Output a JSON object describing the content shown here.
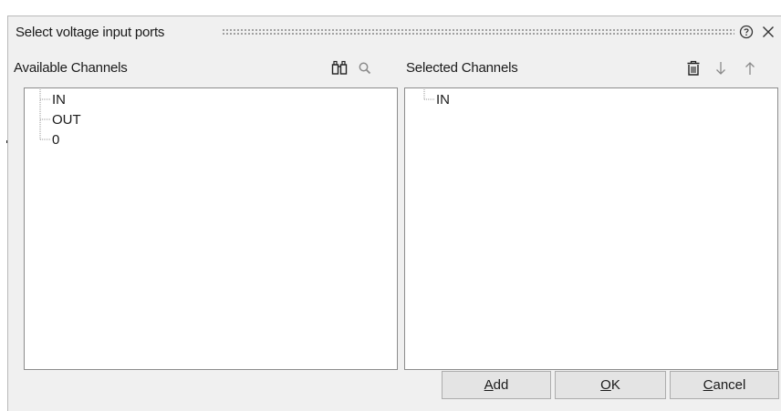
{
  "dialog": {
    "title": "Select voltage input ports",
    "help_icon": "help-circle-icon",
    "close_icon": "close-icon"
  },
  "available": {
    "header": "Available Channels",
    "tools": [
      "binoculars-icon",
      "search-icon"
    ],
    "items": [
      "IN",
      "OUT",
      "0"
    ]
  },
  "selected": {
    "header": "Selected Channels",
    "tools": [
      "trash-icon",
      "arrow-down-icon",
      "arrow-up-icon"
    ],
    "items": [
      "IN"
    ]
  },
  "buttons": {
    "add": {
      "accel": "A",
      "rest": "dd"
    },
    "ok": {
      "accel": "O",
      "rest": "K"
    },
    "cancel": {
      "accel": "C",
      "rest": "ancel"
    }
  }
}
